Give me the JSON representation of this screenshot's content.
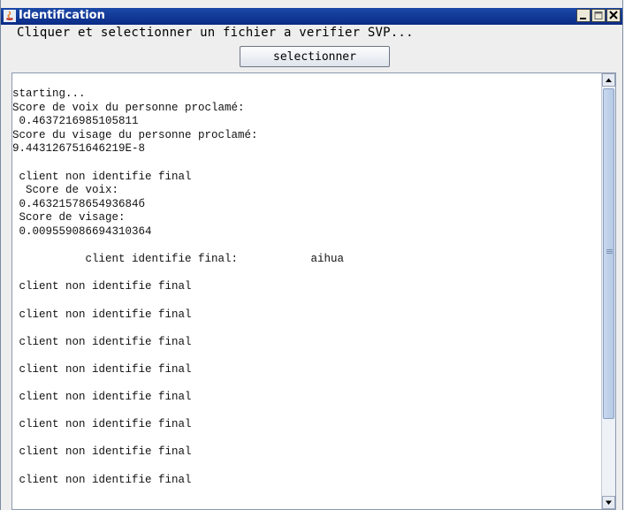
{
  "window": {
    "title": "Identification",
    "icons": [
      "java-app-icon",
      "minimize-icon",
      "maximize-icon",
      "close-icon"
    ]
  },
  "instruction": "Cliquer et selectionner un fichier a verifier SVP...",
  "select_button_label": "selectionner",
  "log_lines": [
    "starting...",
    "Score de voix du personne proclamé:",
    " 0.4637216985105811",
    "Score du visage du personne proclamé:",
    "9.443126751646219E-8",
    "",
    " client non identifie final",
    "  Score de voix:",
    " 0.4632157865493684б",
    " Score de visage:",
    " 0.009559086694310364",
    "",
    "           client identifie final:           aihua",
    "",
    " client non identifie final",
    "",
    " client non identifie final",
    "",
    " client non identifie final",
    "",
    " client non identifie final",
    "",
    " client non identifie final",
    "",
    " client non identifie final",
    "",
    " client non identifie final",
    "",
    " client non identifie final"
  ],
  "scrollbar": {
    "position_fraction": 0.0
  }
}
